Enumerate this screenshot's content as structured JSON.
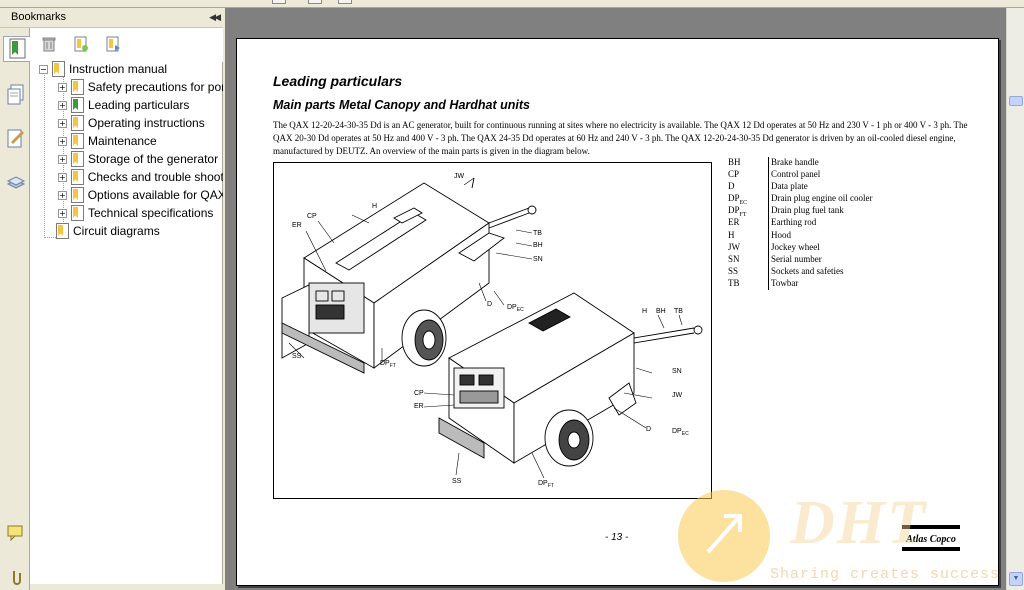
{
  "panel": {
    "title": "Bookmarks",
    "collapse_glyph": "◀◀"
  },
  "bookmarks": {
    "root": "Instruction manual",
    "children": [
      "Safety precautions for portable generators",
      "Leading particulars",
      "Operating instructions",
      "Maintenance",
      "Storage of the generator",
      "Checks and trouble shooting",
      "Options available for QAX",
      "Technical specifications"
    ],
    "sibling": "Circuit diagrams"
  },
  "page": {
    "heading": "Leading particulars",
    "subheading": "Main parts Metal Canopy and Hardhat units",
    "paragraph": "The QAX 12-20-24-30-35 Dd is an AC generator, built for continuous running at sites where no electricity is available. The QAX 12 Dd operates at 50 Hz and 230 V - 1 ph or 400 V - 3 ph. The QAX 20-30 Dd operates at 50 Hz and 400 V - 3 ph. The QAX 24-35 Dd operates at 60 Hz and 240 V - 3 ph. The QAX 12-20-24-30-35 Dd generator is driven by an oil-cooled diesel engine, manufactured by DEUTZ. An overview of the main parts is given in the diagram below.",
    "legend": [
      {
        "code": "BH",
        "sub": "",
        "desc": "Brake handle"
      },
      {
        "code": "CP",
        "sub": "",
        "desc": "Control panel"
      },
      {
        "code": "D",
        "sub": "",
        "desc": "Data plate"
      },
      {
        "code": "DP",
        "sub": "EC",
        "desc": "Drain plug engine oil cooler"
      },
      {
        "code": "DP",
        "sub": "FT",
        "desc": "Drain plug fuel tank"
      },
      {
        "code": "ER",
        "sub": "",
        "desc": "Earthing rod"
      },
      {
        "code": "H",
        "sub": "",
        "desc": "Hood"
      },
      {
        "code": "JW",
        "sub": "",
        "desc": "Jockey wheel"
      },
      {
        "code": "SN",
        "sub": "",
        "desc": "Serial number"
      },
      {
        "code": "SS",
        "sub": "",
        "desc": "Sockets and safeties"
      },
      {
        "code": "TB",
        "sub": "",
        "desc": "Towbar"
      }
    ],
    "page_number": "- 13 -",
    "brand_logo_text": "Atlas Copco"
  },
  "figure_labels": {
    "jw": "JW",
    "h": "H",
    "cp": "CP",
    "er": "ER",
    "tb": "TB",
    "bh": "BH",
    "sn": "SN",
    "d": "D",
    "dp": "DP",
    "ec": "EC",
    "ft": "FT",
    "ss": "SS"
  },
  "watermark": {
    "brand": "DHT",
    "tagline": "Sharing creates success"
  },
  "colors": {
    "bookmark_icon": "#f4c542",
    "page_bg": "#ffffff",
    "doc_bg": "#808080",
    "chrome": "#ece9d8"
  },
  "icons": {
    "rail": [
      "bookmarks-icon",
      "pages-icon",
      "signatures-icon",
      "layers-icon",
      "comments-icon",
      "attachments-icon"
    ],
    "tools": [
      "delete-icon",
      "new-bookmark-icon",
      "expand-bookmark-icon"
    ]
  }
}
